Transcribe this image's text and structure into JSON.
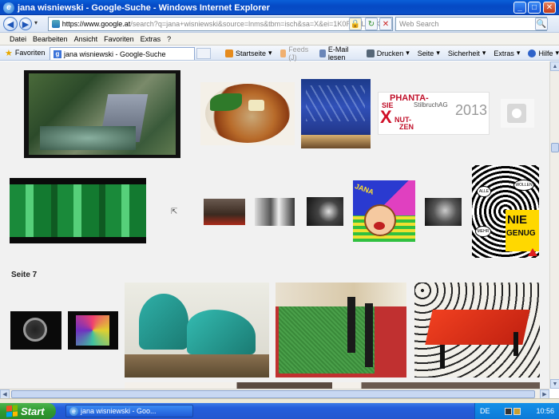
{
  "window": {
    "title": "jana wisniewski - Google-Suche - Windows Internet Explorer",
    "minimize": "_",
    "maximize": "□",
    "close": "✕"
  },
  "address": {
    "scheme": "https://",
    "host": "www.google.at",
    "rest": "/search?q=jana+wisniewski&source=lnms&tbm=isch&sa=X&ei=1K0RUSLBNKWBy+",
    "search_placeholder": "Web Search",
    "search_glyph": "🔍",
    "back_glyph": "◀",
    "forward_glyph": "▶",
    "lock_glyph": "🔒",
    "refresh_glyph": "↻",
    "stop_glyph": "✕"
  },
  "menu": [
    "Datei",
    "Bearbeiten",
    "Ansicht",
    "Favoriten",
    "Extras",
    "?"
  ],
  "favorites_label": "Favoriten",
  "tab": {
    "label": "jana wisniewski - Google-Suche",
    "favicon": "g"
  },
  "commands": [
    {
      "label": "Startseite",
      "color": "#e58b1e",
      "disabled": false
    },
    {
      "label": "Feeds (J)",
      "color": "#f0a050",
      "disabled": true
    },
    {
      "label": "E-Mail lesen",
      "color": "#6a86b8",
      "disabled": false
    },
    {
      "label": "Drucken",
      "color": "#556677",
      "disabled": false
    },
    {
      "label": "Seite",
      "color": "#6b8cc8",
      "disabled": false
    },
    {
      "label": "Sicherheit",
      "color": "#4b7cc7",
      "disabled": false
    },
    {
      "label": "Extras",
      "color": "#8a8a8a",
      "disabled": false
    },
    {
      "label": "Hilfe",
      "color": "#2d62c9",
      "disabled": false
    }
  ],
  "content": {
    "section_label": "Seite 7",
    "tile_2013": {
      "line1": "PHANTA-",
      "line2": "SIE",
      "line3": "StilbruchAG",
      "year": "2013",
      "x": "X",
      "line4": "NUT-",
      "line5": "ZEN"
    },
    "nie_genug": {
      "nie": "NIE",
      "genug": "GENUG",
      "alle": "ALLE",
      "wollen": "WOLLEN",
      "mehr": "MEHR"
    },
    "jana_cartoon": "JANA"
  },
  "scroll": {
    "up": "▲",
    "down": "▼",
    "left": "◀",
    "right": "▶"
  },
  "taskbar": {
    "start": "Start",
    "task": "jana wisniewski - Goo...",
    "lang": "DE",
    "time": "10:56"
  }
}
